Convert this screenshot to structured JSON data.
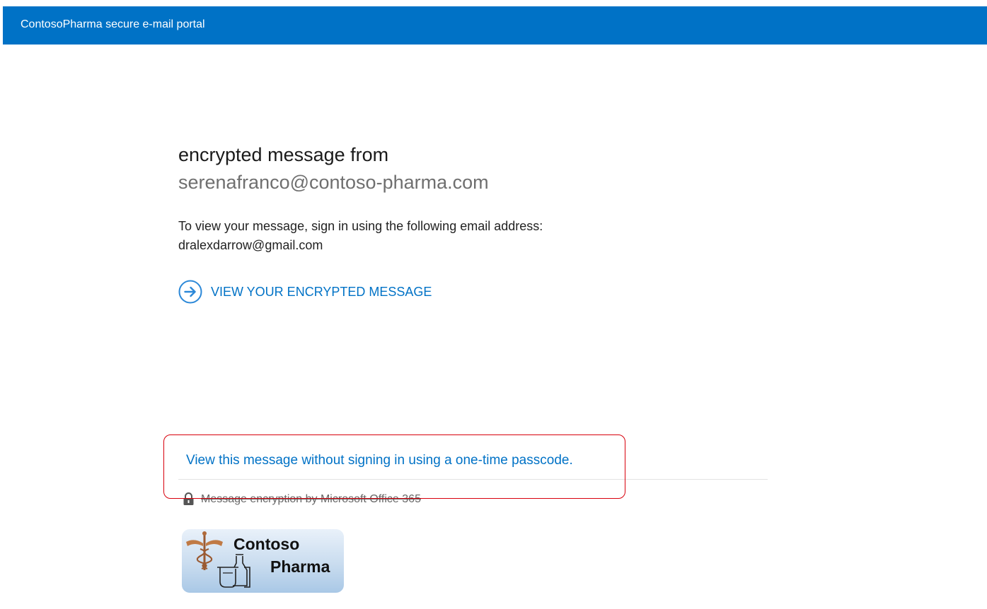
{
  "header": {
    "title": "ContosoPharma secure e-mail portal",
    "background_color": "#0072c6"
  },
  "message": {
    "heading": "encrypted message from",
    "sender": "serenafranco@contoso-pharma.com",
    "instruction": "To view your message, sign in using the following email address:",
    "recipient_email": "dralexdarrow@gmail.com"
  },
  "actions": {
    "view_message_icon": "arrow-right-circle-icon",
    "view_message_label": "VIEW YOUR ENCRYPTED MESSAGE",
    "passcode_link_label": "View this message without signing in using a one-time passcode.",
    "highlight_color": "#d8000c",
    "link_color": "#0072c6"
  },
  "footer": {
    "lock_icon": "lock-icon",
    "text": "Message encryption by Microsoft Office 365"
  },
  "logo": {
    "word1": "Contoso",
    "word2": "Pharma",
    "icon": "caduceus-flask-icon"
  }
}
